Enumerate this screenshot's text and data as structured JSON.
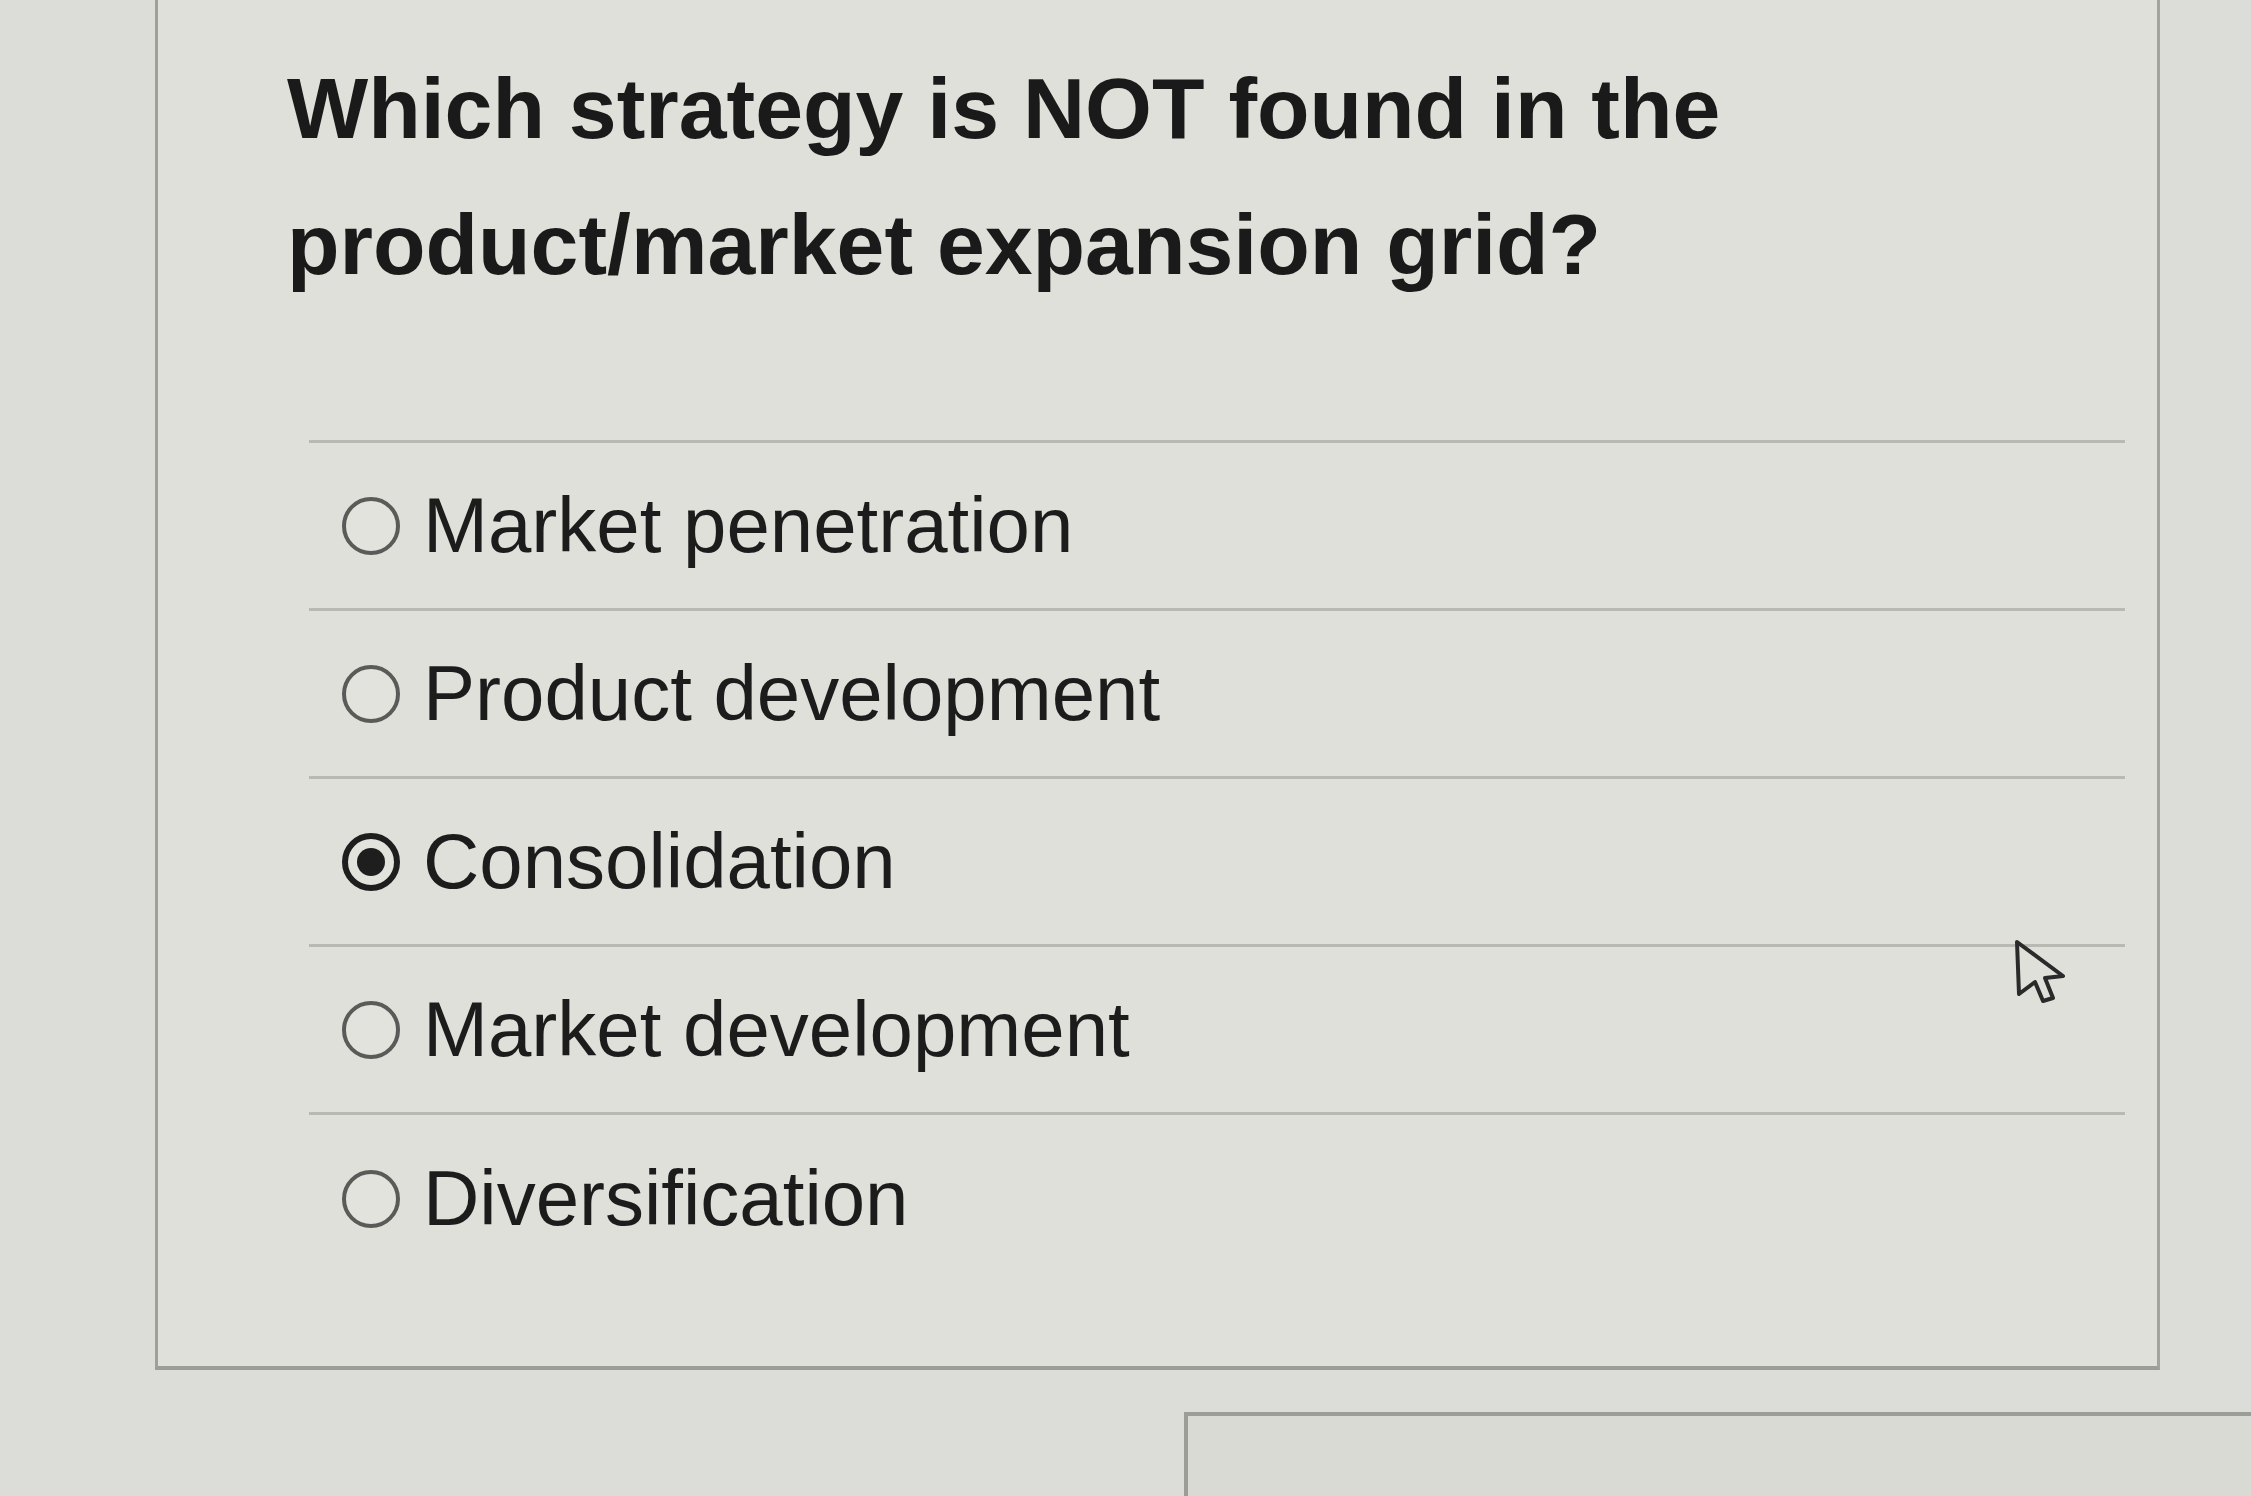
{
  "question": {
    "text": "Which strategy is NOT found in the product/market expansion grid?"
  },
  "options": [
    {
      "label": "Market penetration",
      "selected": false
    },
    {
      "label": "Product development",
      "selected": false
    },
    {
      "label": "Consolidation",
      "selected": true
    },
    {
      "label": "Market development",
      "selected": false
    },
    {
      "label": "Diversification",
      "selected": false
    }
  ]
}
